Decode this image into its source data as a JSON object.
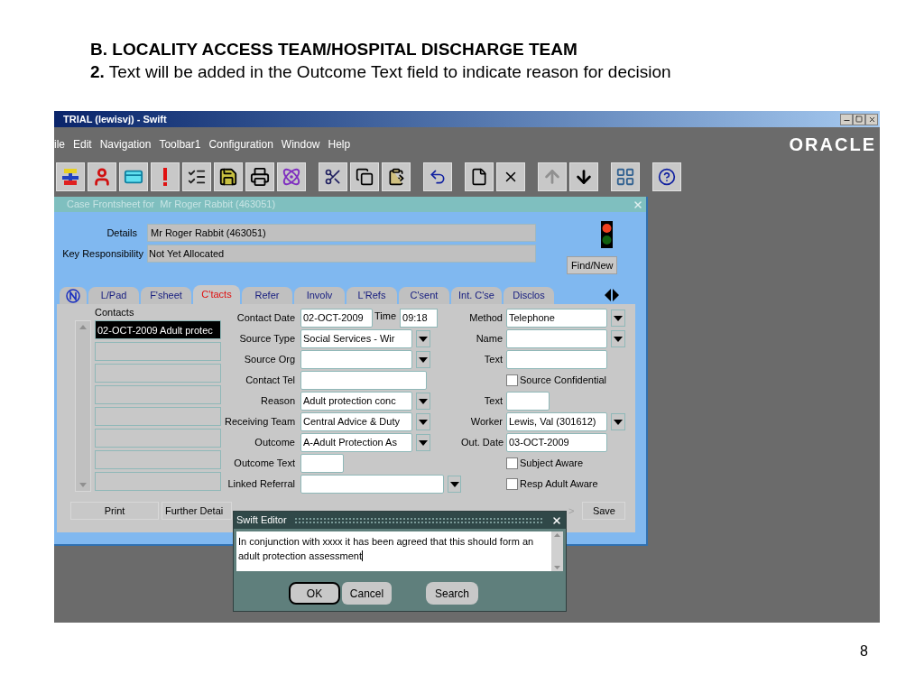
{
  "slide": {
    "heading": "B. LOCALITY ACCESS TEAM/HOSPITAL DISCHARGE TEAM",
    "subheading": "**2.** Text will be added in the Outcome Text field to indicate reason for decision",
    "page_number": "8"
  },
  "app": {
    "title": "TRIAL (lewisvj) - Swift",
    "menu": [
      "ile",
      "Edit",
      "Navigation",
      "Toolbar1",
      "Configuration",
      "Window",
      "Help"
    ],
    "brand": "ORACLE"
  },
  "form": {
    "title": "Case Frontsheet for  Mr Roger Rabbit (463051)",
    "details_label": "Details",
    "details": "Mr Roger Rabbit (463051)",
    "responsibility_label": "Key Responsibility",
    "responsibility": "Not Yet Allocated",
    "find_button": "Find/New",
    "tabs": [
      {
        "label": "L/Pad",
        "selected": false
      },
      {
        "label": "F'sheet",
        "selected": false
      },
      {
        "label": "C'tacts",
        "selected": true
      },
      {
        "label": "Refer",
        "selected": false
      },
      {
        "label": "Involv",
        "selected": false
      },
      {
        "label": "L'Refs",
        "selected": false
      },
      {
        "label": "C'sent",
        "selected": false
      },
      {
        "label": "Int. C'se",
        "selected": false
      },
      {
        "label": "Disclos",
        "selected": false
      }
    ],
    "contacts_label": "Contacts",
    "contacts": [
      {
        "text": "02-OCT-2009 Adult protec",
        "selected": true
      }
    ],
    "rows": [
      {
        "left": {
          "kind": "input",
          "label": "Contact Date",
          "value": "02-OCT-2009",
          "extra": {
            "label": "Time",
            "value": "09:18"
          }
        },
        "right": {
          "kind": "combo",
          "label": "Method",
          "value": "Telephone"
        }
      },
      {
        "left": {
          "kind": "combo",
          "label": "Source Type",
          "value": "Social Services - Wir"
        },
        "right": {
          "kind": "combo",
          "label": "Name"
        }
      },
      {
        "left": {
          "kind": "combo",
          "label": "Source Org"
        },
        "right": {
          "kind": "input",
          "label": "Text"
        }
      },
      {
        "left": {
          "kind": "input",
          "label": "Contact Tel"
        },
        "right": {
          "kind": "checkbox",
          "label": "Source Confidential",
          "checked": false
        }
      },
      {
        "left": {
          "kind": "combo",
          "label": "Reason",
          "value": "Adult protection conc"
        },
        "right": {
          "kind": "short",
          "label": "Text"
        }
      },
      {
        "left": {
          "kind": "combo",
          "label": "Receiving Team",
          "value": "Central Advice & Duty"
        },
        "right": {
          "kind": "combo",
          "label": "Worker",
          "value": "Lewis, Val (301612)"
        }
      },
      {
        "left": {
          "kind": "combo",
          "label": "Outcome",
          "value": "A-Adult Protection As"
        },
        "right": {
          "kind": "input",
          "label": "Out. Date",
          "value": "03-OCT-2009"
        }
      },
      {
        "left": {
          "kind": "short",
          "label": "Outcome Text"
        },
        "right": {
          "kind": "checkbox",
          "label": "Subject Aware",
          "checked": false
        }
      },
      {
        "left": {
          "kind": "wide-combo",
          "label": "Linked Referral"
        },
        "right": {
          "kind": "checkbox",
          "label": "Resp Adult Aware",
          "checked": false
        }
      }
    ],
    "buttons": [
      "Print",
      "Further Detai",
      ">",
      "Save"
    ]
  },
  "editor": {
    "title": "Swift Editor",
    "text": "In conjunction with xxxx it has been agreed that this should form an adult protection assessment",
    "buttons": [
      "OK",
      "Cancel",
      "Search"
    ]
  }
}
